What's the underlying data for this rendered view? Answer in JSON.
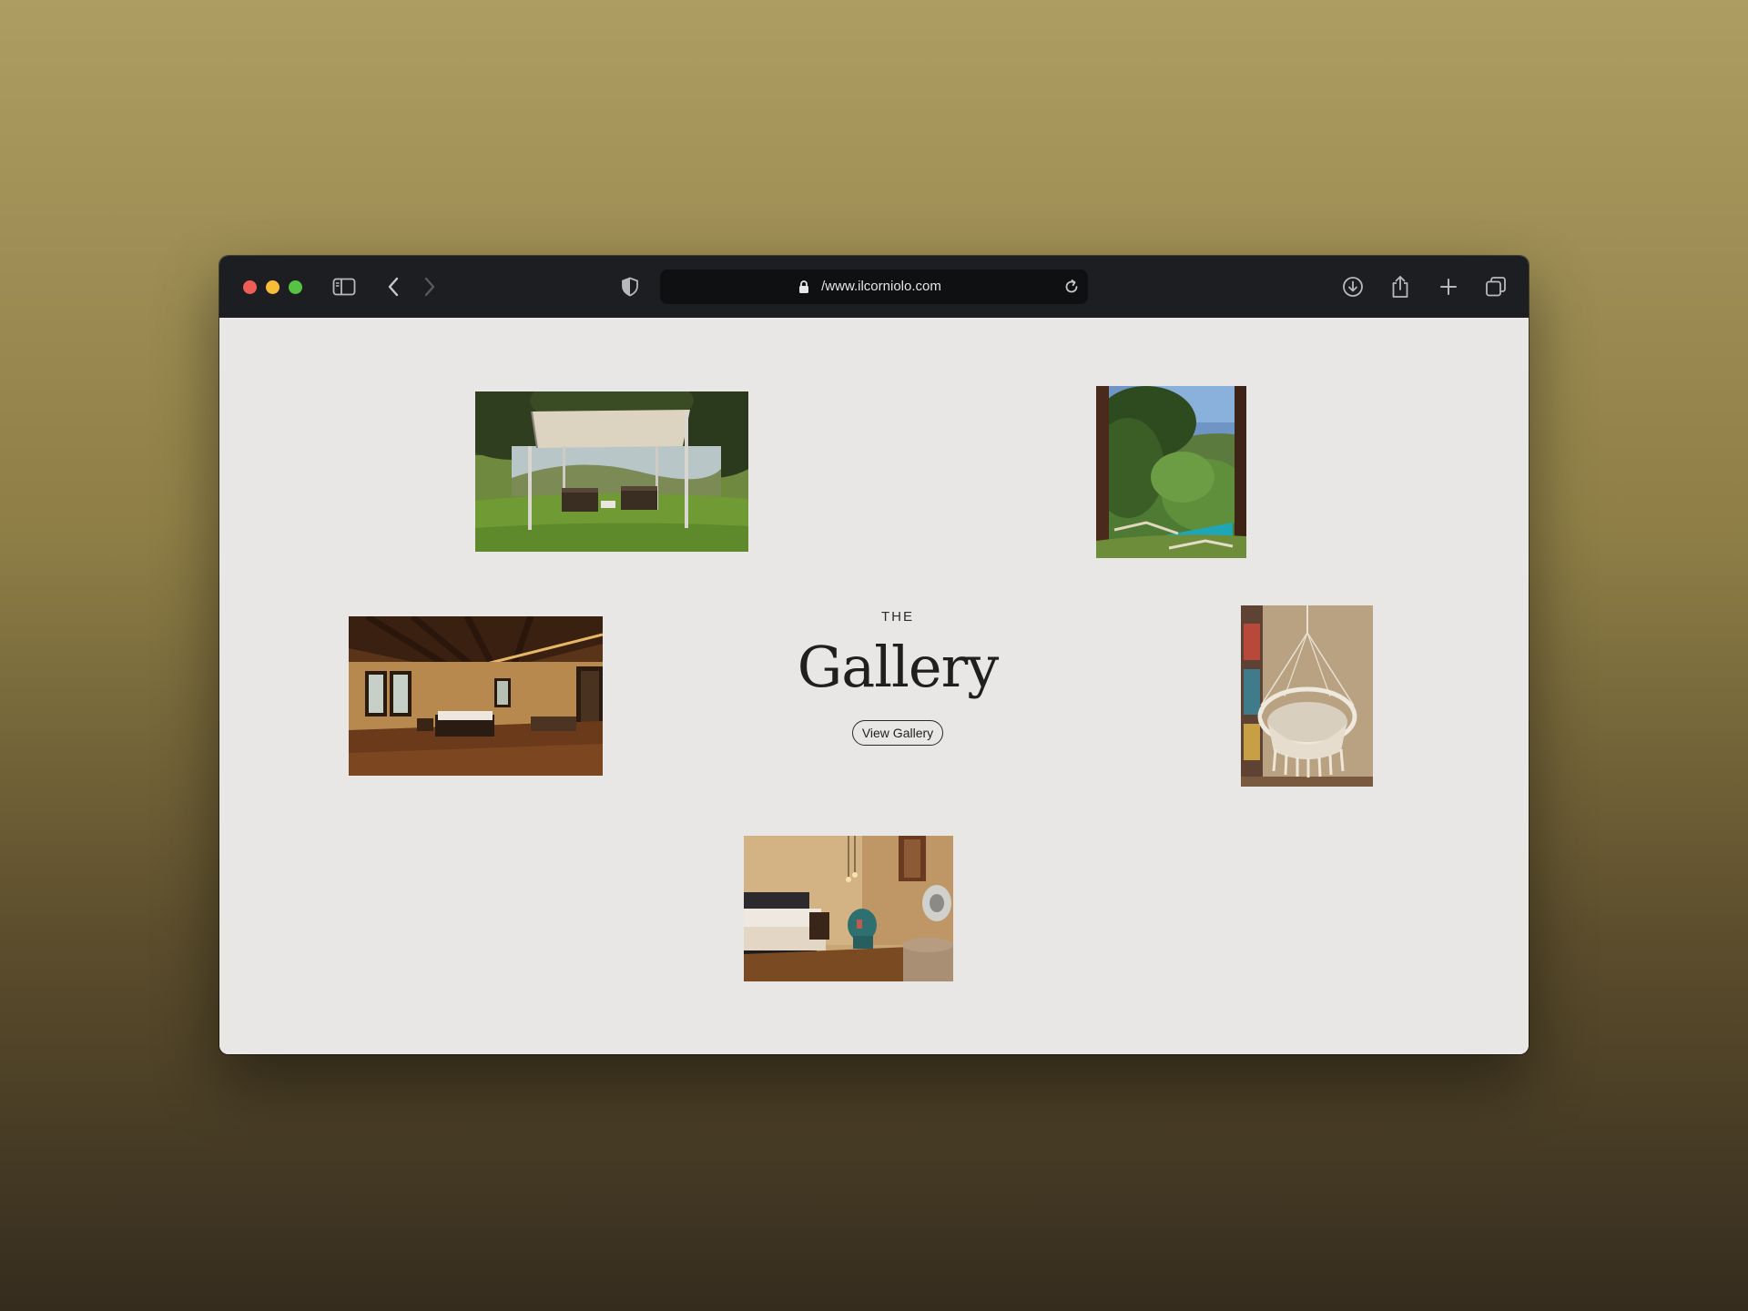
{
  "browser": {
    "url": "/www.ilcorniolo.com",
    "icons": {
      "sidebar": "sidebar-icon",
      "back": "chevron-left-icon",
      "forward": "chevron-right-icon",
      "privacy": "shield-icon",
      "lock": "lock-icon",
      "reload": "reload-icon",
      "download": "download-icon",
      "share": "share-icon",
      "new_tab": "plus-icon",
      "tabs": "tabs-overview-icon"
    }
  },
  "section": {
    "kicker": "THE",
    "title": "Gallery",
    "button_label": "View Gallery"
  },
  "gallery": {
    "photos": [
      {
        "name": "pergola-with-loungers"
      },
      {
        "name": "pool-garden-view"
      },
      {
        "name": "bedroom-wood-beams"
      },
      {
        "name": "hanging-macrame-chair"
      },
      {
        "name": "bedroom-with-chair"
      }
    ]
  },
  "colors": {
    "desktop_top": "#ad9d62",
    "desktop_bottom": "#352c1e",
    "toolbar": "#1d1e21",
    "page_bg": "#e8e7e5",
    "text": "#1f1f1f"
  }
}
